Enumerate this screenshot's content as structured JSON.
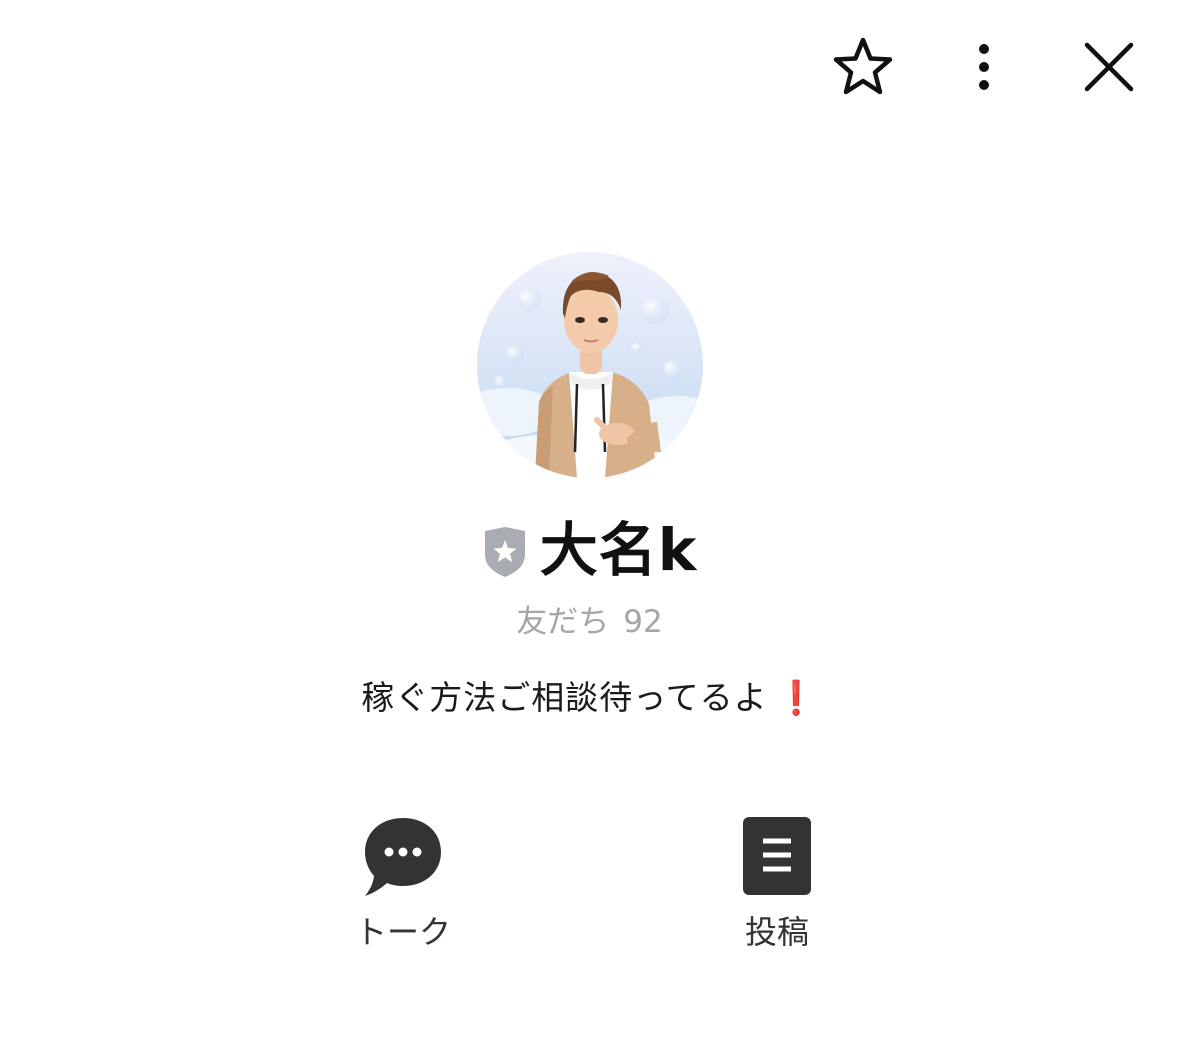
{
  "toolbar": {
    "favorite_icon": "star-outline-icon",
    "more_icon": "vertical-ellipsis-icon",
    "close_icon": "close-x-icon"
  },
  "profile": {
    "name": "大名k",
    "badge_icon": "shield-star-icon",
    "friends_label": "友だち",
    "friends_count": "92",
    "status_message": "稼ぐ方法ご相談待ってるよ",
    "status_emoji": "❗"
  },
  "actions": [
    {
      "label": "トーク",
      "icon": "chat-bubble-icon"
    },
    {
      "label": "投稿",
      "icon": "document-list-icon"
    }
  ],
  "colors": {
    "icon_dark": "#333333",
    "name_text": "#111111",
    "friends_text": "#a6a6a6",
    "badge_gray": "#a9adb3",
    "emoji_red": "#e1051b"
  }
}
